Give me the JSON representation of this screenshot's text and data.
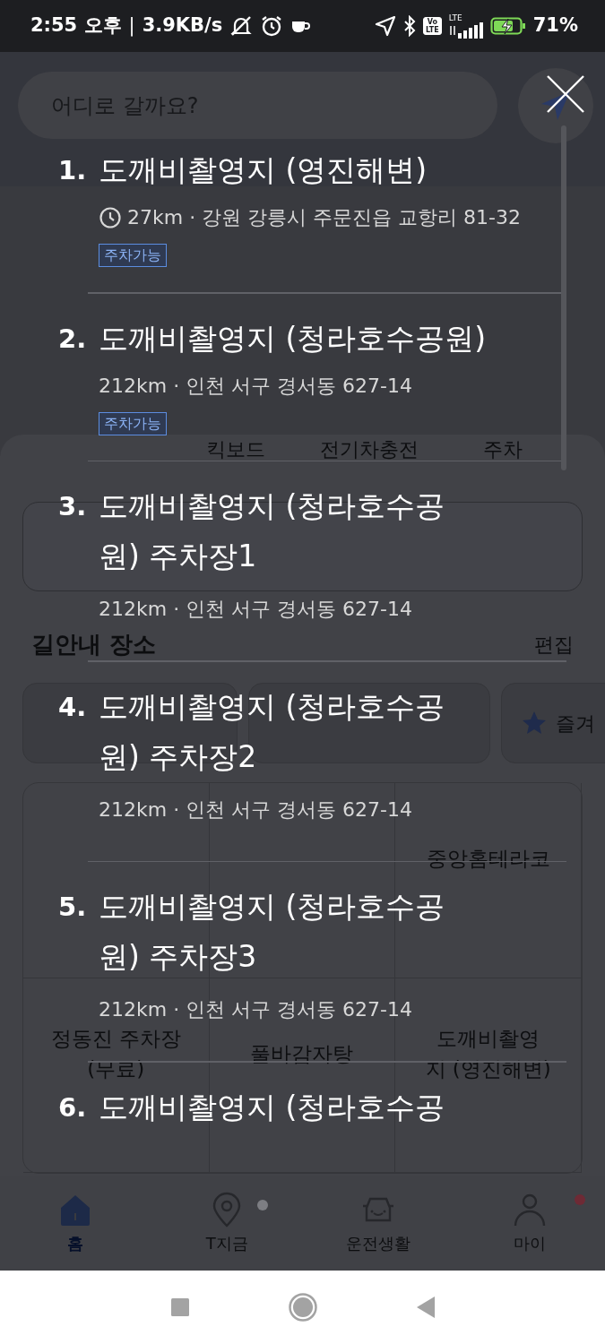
{
  "status_bar": {
    "time": "2:55 오후",
    "separator": "|",
    "network_speed": "3.9KB/s",
    "volte": [
      "Vo",
      "LTE"
    ],
    "network_type": "LTE",
    "battery": "71%"
  },
  "background": {
    "search": {
      "placeholder": "어디로 갈까요?"
    },
    "categories": [
      {
        "kind": "covered"
      },
      {
        "kind": "label",
        "label": "킥보드"
      },
      {
        "kind": "label",
        "label": "전기차충전"
      },
      {
        "kind": "label",
        "label": "주차"
      }
    ],
    "section_title": "길안내 장소",
    "edit": "편집",
    "quick_cards": [
      {
        "kind": "covered"
      },
      {
        "kind": "covered"
      },
      {
        "kind": "favorite",
        "label": "즐겨"
      }
    ],
    "favorites": [
      {
        "kind": "covered"
      },
      {
        "kind": "covered"
      },
      {
        "kind": "label",
        "lines": [
          "중앙홈테라코"
        ]
      },
      {
        "kind": "label",
        "lines": [
          "정동진 주차장",
          "(무료)"
        ]
      },
      {
        "kind": "label",
        "lines": [
          "풀바감자탕"
        ]
      },
      {
        "kind": "label",
        "lines": [
          "도깨비촬영",
          "지 (영진해변)"
        ]
      }
    ],
    "bottom_nav": [
      {
        "label": "홈",
        "selected": true
      },
      {
        "label": "T지금",
        "selected": false,
        "dot": {
          "color": "#7d7e83"
        }
      },
      {
        "label": "운전생활",
        "selected": false
      },
      {
        "label": "마이",
        "selected": false,
        "dot": {
          "color": "#6e2a35"
        }
      }
    ]
  },
  "results": [
    {
      "number": "1.",
      "title_lines": [
        "도깨비촬영지 (영진해변)"
      ],
      "recent": true,
      "address": "27km · 강원 강릉시 주문진읍 교항리 81-32",
      "badge": "주차가능"
    },
    {
      "number": "2.",
      "title_lines": [
        "도깨비촬영지 (청라호수공원)"
      ],
      "recent": false,
      "address": "212km · 인천 서구 경서동 627-14",
      "badge": "주차가능"
    },
    {
      "number": "3.",
      "title_lines": [
        "도깨비촬영지 (청라호수공",
        "원) 주차장1"
      ],
      "recent": false,
      "address": "212km · 인천 서구 경서동 627-14"
    },
    {
      "number": "4.",
      "title_lines": [
        "도깨비촬영지 (청라호수공",
        "원) 주차장2"
      ],
      "recent": false,
      "address": "212km · 인천 서구 경서동 627-14"
    },
    {
      "number": "5.",
      "title_lines": [
        "도깨비촬영지 (청라호수공",
        "원) 주차장3"
      ],
      "recent": false,
      "address": "212km · 인천 서구 경서동 627-14"
    },
    {
      "number": "6.",
      "title_lines": [
        "도깨비촬영지 (청라호수공"
      ],
      "recent": false
    }
  ]
}
